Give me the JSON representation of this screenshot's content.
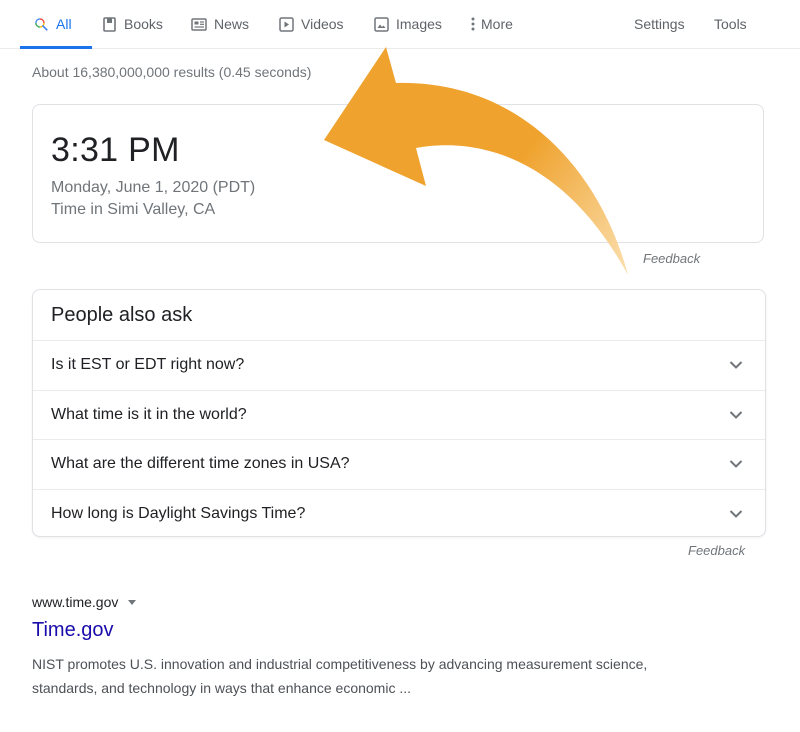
{
  "nav": {
    "tabs": [
      {
        "label": "All",
        "icon": "search-icon",
        "active": true
      },
      {
        "label": "Books",
        "icon": "book-icon",
        "active": false
      },
      {
        "label": "News",
        "icon": "news-icon",
        "active": false
      },
      {
        "label": "Videos",
        "icon": "video-play-icon",
        "active": false
      },
      {
        "label": "Images",
        "icon": "image-icon",
        "active": false
      },
      {
        "label": "More",
        "icon": "more-vert-icon",
        "active": false
      }
    ],
    "settings_label": "Settings",
    "tools_label": "Tools",
    "accent_color": "#1a73e8"
  },
  "result_stats": "About 16,380,000,000 results (0.45 seconds)",
  "time_card": {
    "time": "3:31 PM",
    "date": "Monday, June 1, 2020 (PDT)",
    "location": "Time in Simi Valley, CA",
    "feedback_label": "Feedback"
  },
  "people_also_ask": {
    "title": "People also ask",
    "questions": [
      "Is it EST or EDT right now?",
      "What time is it in the world?",
      "What are the different time zones in USA?",
      "How long is Daylight Savings Time?"
    ],
    "feedback_label": "Feedback"
  },
  "result": {
    "url": "www.time.gov",
    "title": "Time.gov",
    "snippet": "NIST promotes U.S. innovation and industrial competitiveness by advancing measurement science, standards, and technology in ways that enhance economic ...",
    "title_color": "#1a0dab"
  },
  "annotation": {
    "type": "curved-arrow",
    "color": "#efa22d",
    "points_to": "Images tab"
  }
}
